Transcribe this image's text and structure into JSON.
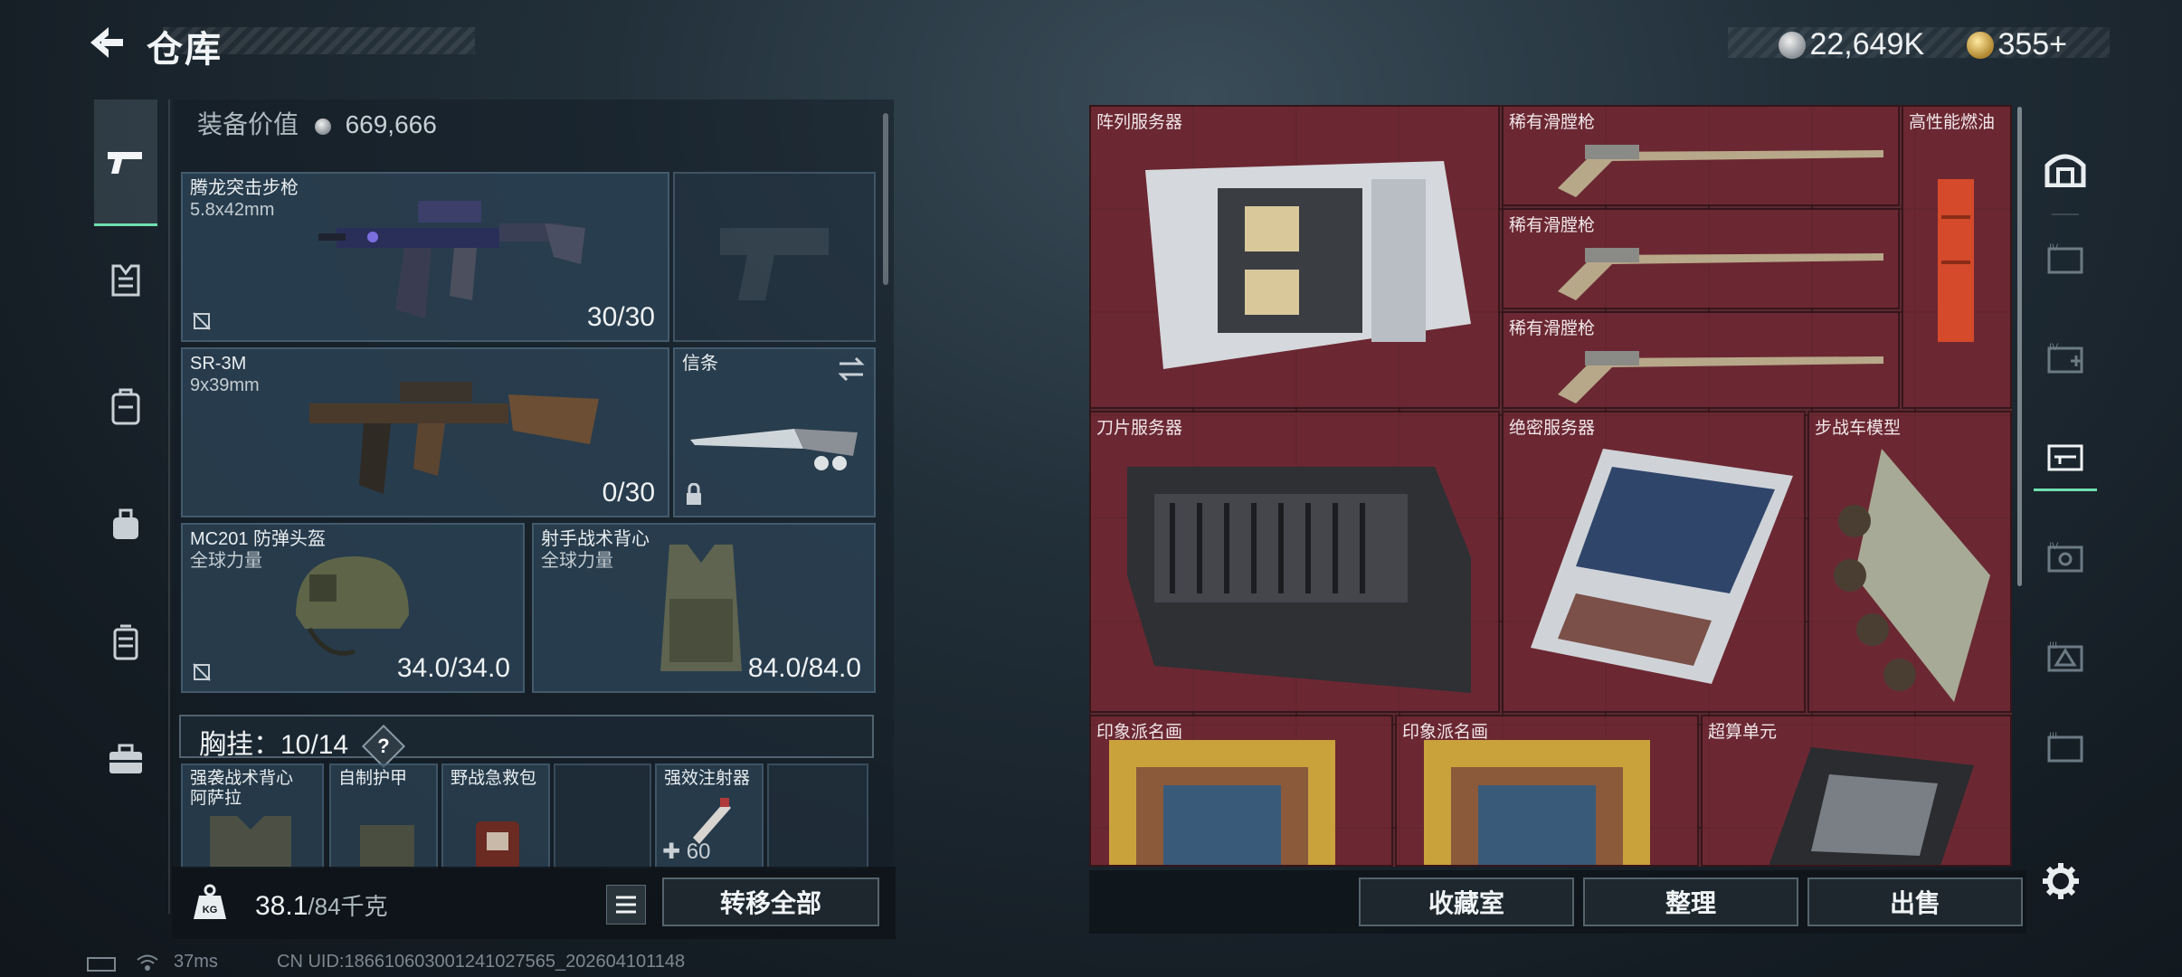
{
  "header": {
    "title": "仓库"
  },
  "currency": {
    "silver": "22,649K",
    "gold": "355+"
  },
  "inventory": {
    "equip_value_label": "装备价值",
    "equip_value": "669,666",
    "primary": {
      "name": "腾龙突击步枪",
      "caliber": "5.8x42mm",
      "ammo": "30/30"
    },
    "secondary": {
      "name": "SR-3M",
      "caliber": "9x39mm",
      "ammo": "0/30"
    },
    "melee": {
      "name": "信条"
    },
    "helmet": {
      "name": "MC201 防弹头盔",
      "brand": "全球力量",
      "durability": "34.0/34.0"
    },
    "armor": {
      "name": "射手战术背心",
      "brand": "全球力量",
      "durability": "84.0/84.0"
    },
    "chest_rig": {
      "label": "胸挂：10/14",
      "help": "?"
    },
    "rig_slots": [
      {
        "name": "强袭战术背心",
        "sub": "阿萨拉"
      },
      {
        "name": "自制护甲",
        "sub": ""
      },
      {
        "name": "野战急救包",
        "sub": ""
      },
      {
        "name": "",
        "sub": ""
      },
      {
        "name": "强效注射器",
        "sub": "",
        "count": "60"
      },
      {
        "name": "",
        "sub": ""
      }
    ],
    "weight": {
      "current": "38.1",
      "max": "/84千克"
    },
    "transfer_all": "转移全部"
  },
  "stash": {
    "items": [
      {
        "name": "阵列服务器"
      },
      {
        "name": "稀有滑膛枪"
      },
      {
        "name": "稀有滑膛枪"
      },
      {
        "name": "稀有滑膛枪"
      },
      {
        "name": "高性能燃油"
      },
      {
        "name": "刀片服务器"
      },
      {
        "name": "绝密服务器"
      },
      {
        "name": "步战车模型"
      },
      {
        "name": "印象派名画"
      },
      {
        "name": "印象派名画"
      },
      {
        "name": "超算单元"
      }
    ],
    "buttons": {
      "collection": "收藏室",
      "organize": "整理",
      "sell": "出售"
    }
  },
  "status": {
    "ping": "37ms",
    "uid": "CN UID:186610603001241027565_202604101148"
  },
  "colors": {
    "accent": "#6fe0b0",
    "stash_bg": "#5a2a30",
    "slot_bg": "#2e4658"
  }
}
